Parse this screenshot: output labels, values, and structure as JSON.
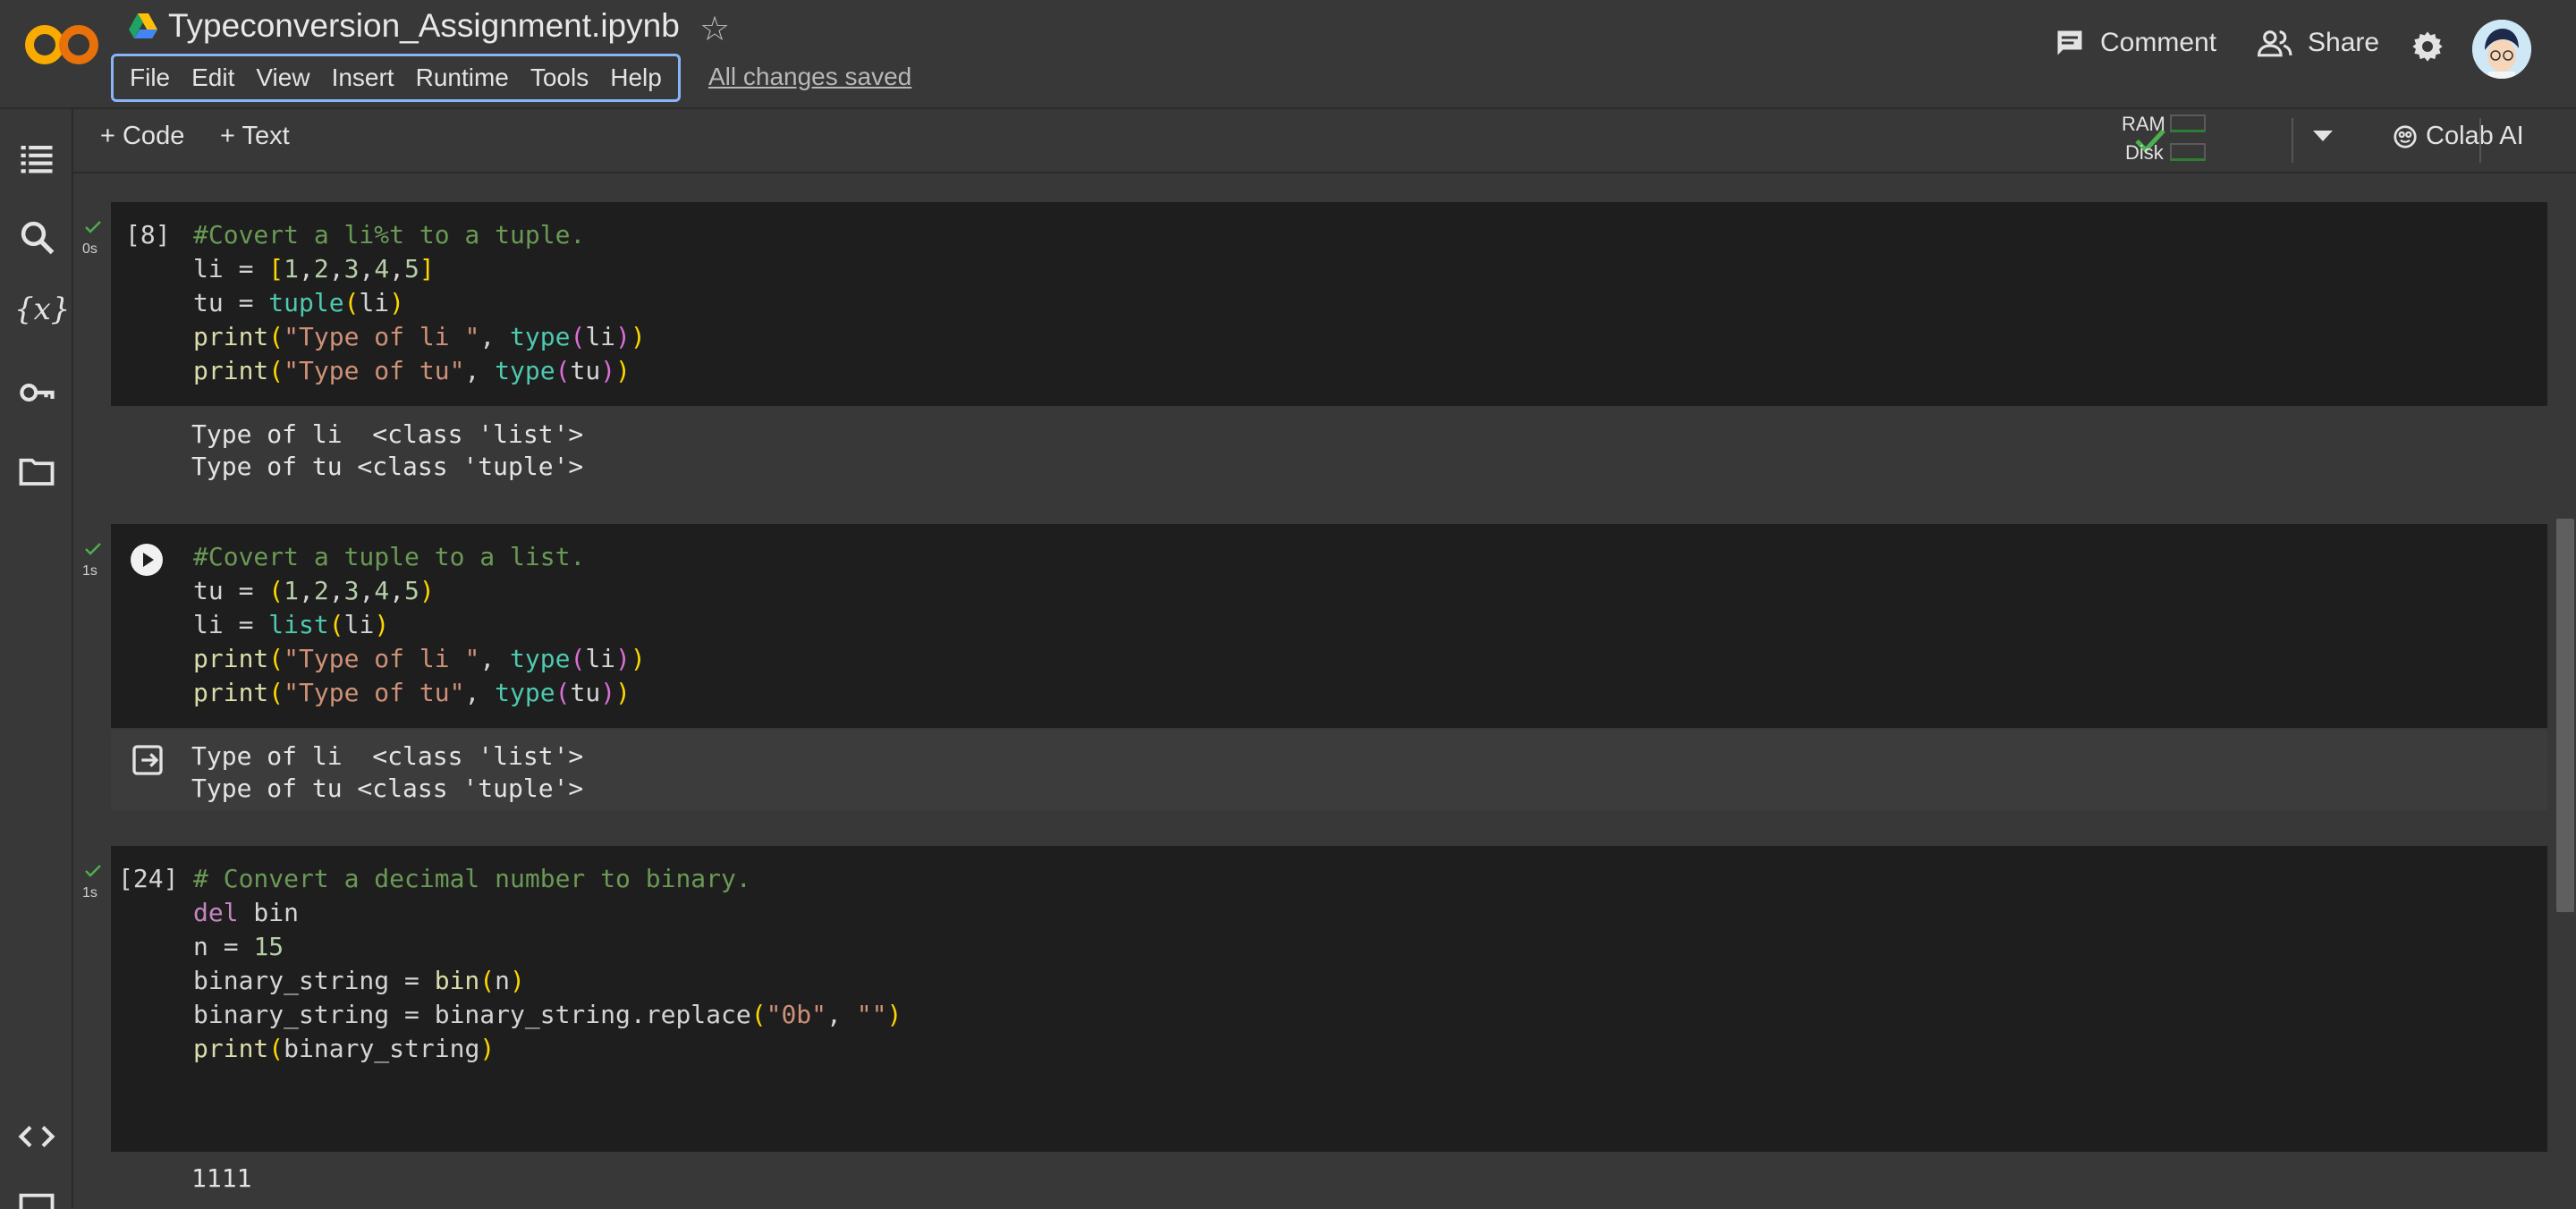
{
  "app": {
    "title": "Typeconversion_Assignment.ipynb",
    "save_status": "All changes saved",
    "menu": [
      "File",
      "Edit",
      "View",
      "Insert",
      "Runtime",
      "Tools",
      "Help"
    ],
    "comment_label": "Comment",
    "share_label": "Share"
  },
  "toolbar": {
    "code_label": "+ Code",
    "text_label": "+ Text",
    "ram_label": "RAM",
    "disk_label": "Disk",
    "colab_ai_label": "Colab AI"
  },
  "colors": {
    "background": "#383838",
    "cell_background": "#1e1e1e",
    "accent": "#8ab4f8",
    "success": "#4caf50"
  },
  "cells": [
    {
      "exec_count": "[8]",
      "exec_time": "0s",
      "code": [
        "#Covert a li%t to a tuple.",
        "li = [1,2,3,4,5]",
        "tu = tuple(li)",
        "print(\"Type of li \", type(li))",
        "print(\"Type of tu\", type(tu))"
      ],
      "output": [
        "Type of li  <class 'list'>",
        "Type of tu <class 'tuple'>"
      ]
    },
    {
      "exec_count": "",
      "exec_time": "1s",
      "code": [
        "#Covert a tuple to a list.",
        "tu = (1,2,3,4,5)",
        "li = list(li)",
        "print(\"Type of li \", type(li))",
        "print(\"Type of tu\", type(tu))"
      ],
      "output": [
        "Type of li  <class 'list'>",
        "Type of tu <class 'tuple'>"
      ]
    },
    {
      "exec_count": "[24]",
      "exec_time": "1s",
      "code": [
        "# Convert a decimal number to binary.",
        "del bin",
        "n = 15",
        "binary_string = bin(n)",
        "binary_string = binary_string.replace(\"0b\", \"\")",
        "print(binary_string)"
      ],
      "output": [
        "1111"
      ]
    }
  ],
  "icons": {
    "sidebar": [
      "table-of-contents-icon",
      "search-icon",
      "variables-icon",
      "secrets-key-icon",
      "files-folder-icon",
      "code-snippets-icon"
    ]
  }
}
